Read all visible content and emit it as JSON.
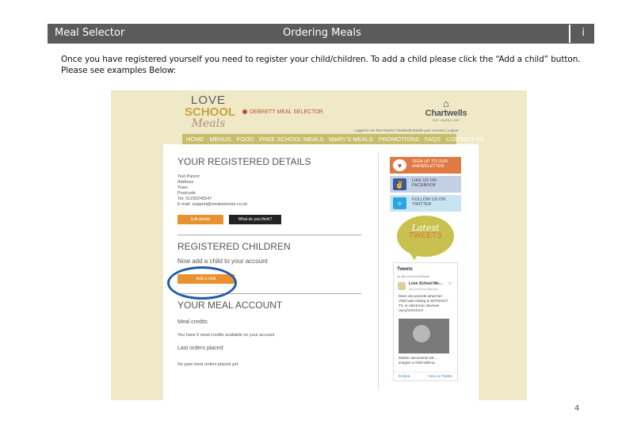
{
  "header": {
    "left_title": "Meal Selector",
    "center_title": "Ordering Meals",
    "info_label": "i"
  },
  "intro": {
    "line1": "Once you have registered yourself you need to register your child/children. To add a child please click the “Add a child” button.",
    "line2": "Please see examples Below:"
  },
  "screenshot": {
    "logo": {
      "line1": "LOVE",
      "line2": "SCHOOL",
      "line3": "Meals"
    },
    "site_label": "DEBRETT MEAL SELECTOR",
    "brand": {
      "name": "Chartwells",
      "tagline": "EAT. LEARN. LIVE"
    },
    "account_links": "Logged in as Test Parent  |  View/Edit Details your account  |  Logout",
    "nav": [
      "HOME",
      "MENUS",
      "FOOD",
      "FREE SCHOOL MEALS",
      "MARY'S MEALS",
      "PROMOTIONS",
      "FAQS",
      "CONTACT US"
    ],
    "details": {
      "title": "YOUR REGISTERED DETAILS",
      "lines": [
        "Test Parent",
        "Address",
        "Town",
        "Postcode",
        "Tel: 01159245547",
        "E-mail: support@mealselector.co.uk"
      ],
      "edit_button": "Edit details",
      "feedback_button": "What do you think?"
    },
    "children": {
      "title": "REGISTERED CHILDREN",
      "prompt": "Now add a child to your account",
      "add_button": "Add a child"
    },
    "meal_account": {
      "title": "YOUR MEAL ACCOUNT",
      "credits_heading": "Meal credits",
      "credits_text": "You have 0 meal credits available on your account",
      "orders_heading": "Last orders placed",
      "orders_text": "No past meal orders placed yet."
    },
    "social": {
      "signup": "SIGN UP TO OUR eNEWSLETTER",
      "facebook": "LIKE US ON FACEBOOK",
      "twitter": "FOLLOW US ON TWITTER"
    },
    "latest_tweets": {
      "line1": "Latest",
      "line2": "TWEETS"
    },
    "tweets": {
      "heading": "Tweets",
      "by": "by @LoveSchoolMeals",
      "name": "Love School Me...",
      "handle": "@LoveSchoolMeals",
      "body": "Mum documents what her\nchild was eating & WITHOUT\nTV or electronic devices\now.ly/XXXXXX",
      "caption": "Mother documents wh...\nimagine a child withcut...",
      "embed": "Embed",
      "view": "View on Twitter"
    }
  },
  "page_number": "4",
  "colors": {
    "header_bg": "#5b5b5b",
    "screenshot_bg": "#efe9c7",
    "nav_bg": "#c8bd6a",
    "button_orange": "#e8912e",
    "highlight_ring": "#1f5ca7"
  }
}
